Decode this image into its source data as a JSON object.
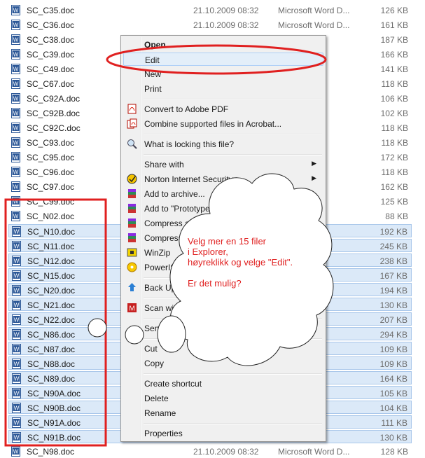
{
  "files": [
    {
      "name": "SC_C35.doc",
      "date": "21.10.2009 08:32",
      "type": "Microsoft Word D...",
      "size": "126 KB",
      "selected": false
    },
    {
      "name": "SC_C36.doc",
      "date": "21.10.2009 08:32",
      "type": "Microsoft Word D...",
      "size": "161 KB",
      "selected": false
    },
    {
      "name": "SC_C38.doc",
      "date": "",
      "type": "",
      "size": "187 KB",
      "selected": false
    },
    {
      "name": "SC_C39.doc",
      "date": "",
      "type": "",
      "size": "166 KB",
      "selected": false
    },
    {
      "name": "SC_C49.doc",
      "date": "",
      "type": "",
      "size": "141 KB",
      "selected": false
    },
    {
      "name": "SC_C67.doc",
      "date": "",
      "type": "",
      "size": "118 KB",
      "selected": false
    },
    {
      "name": "SC_C92A.doc",
      "date": "",
      "type": "",
      "size": "106 KB",
      "selected": false
    },
    {
      "name": "SC_C92B.doc",
      "date": "",
      "type": "",
      "size": "102 KB",
      "selected": false
    },
    {
      "name": "SC_C92C.doc",
      "date": "",
      "type": "",
      "size": "118 KB",
      "selected": false
    },
    {
      "name": "SC_C93.doc",
      "date": "",
      "type": "",
      "size": "118 KB",
      "selected": false
    },
    {
      "name": "SC_C95.doc",
      "date": "",
      "type": "",
      "size": "172 KB",
      "selected": false
    },
    {
      "name": "SC_C96.doc",
      "date": "",
      "type": "",
      "size": "118 KB",
      "selected": false
    },
    {
      "name": "SC_C97.doc",
      "date": "",
      "type": "",
      "size": "162 KB",
      "selected": false
    },
    {
      "name": "SC_C99.doc",
      "date": "",
      "type": "",
      "size": "125 KB",
      "selected": false
    },
    {
      "name": "SC_N02.doc",
      "date": "",
      "type": "",
      "size": "88 KB",
      "selected": false
    },
    {
      "name": "SC_N10.doc",
      "date": "",
      "type": "",
      "size": "192 KB",
      "selected": true
    },
    {
      "name": "SC_N11.doc",
      "date": "",
      "type": "",
      "size": "245 KB",
      "selected": true
    },
    {
      "name": "SC_N12.doc",
      "date": "",
      "type": "",
      "size": "238 KB",
      "selected": true
    },
    {
      "name": "SC_N15.doc",
      "date": "",
      "type": "",
      "size": "167 KB",
      "selected": true
    },
    {
      "name": "SC_N20.doc",
      "date": "",
      "type": "",
      "size": "194 KB",
      "selected": true
    },
    {
      "name": "SC_N21.doc",
      "date": "",
      "type": "",
      "size": "130 KB",
      "selected": true
    },
    {
      "name": "SC_N22.doc",
      "date": "",
      "type": "",
      "size": "207 KB",
      "selected": true
    },
    {
      "name": "SC_N86.doc",
      "date": "",
      "type": "",
      "size": "294 KB",
      "selected": true
    },
    {
      "name": "SC_N87.doc",
      "date": "",
      "type": "",
      "size": "109 KB",
      "selected": true
    },
    {
      "name": "SC_N88.doc",
      "date": "",
      "type": "",
      "size": "109 KB",
      "selected": true
    },
    {
      "name": "SC_N89.doc",
      "date": "",
      "type": "",
      "size": "164 KB",
      "selected": true
    },
    {
      "name": "SC_N90A.doc",
      "date": "",
      "type": "",
      "size": "105 KB",
      "selected": true
    },
    {
      "name": "SC_N90B.doc",
      "date": "",
      "type": "",
      "size": "104 KB",
      "selected": true
    },
    {
      "name": "SC_N91A.doc",
      "date": "",
      "type": "",
      "size": "111 KB",
      "selected": true
    },
    {
      "name": "SC_N91B.doc",
      "date": "",
      "type": "",
      "size": "130 KB",
      "selected": true
    },
    {
      "name": "SC_N98.doc",
      "date": "21.10.2009 08:32",
      "type": "Microsoft Word D...",
      "size": "128 KB",
      "selected": false
    }
  ],
  "menu": {
    "items": [
      {
        "label": "Open",
        "icon": "",
        "bold": true,
        "submenu": false
      },
      {
        "label": "Edit",
        "icon": "",
        "bold": false,
        "submenu": false,
        "highlighted": true
      },
      {
        "label": "New",
        "icon": "",
        "bold": false,
        "submenu": false
      },
      {
        "label": "Print",
        "icon": "",
        "bold": false,
        "submenu": false
      },
      {
        "sep": true
      },
      {
        "label": "Convert to Adobe PDF",
        "icon": "pdf-icon",
        "bold": false,
        "submenu": false
      },
      {
        "label": "Combine supported files in Acrobat...",
        "icon": "acrobat-combine-icon",
        "bold": false,
        "submenu": false
      },
      {
        "sep": true
      },
      {
        "label": "What is locking this file?",
        "icon": "magnifier-lock-icon",
        "bold": false,
        "submenu": false
      },
      {
        "sep": true
      },
      {
        "label": "Share with",
        "icon": "",
        "bold": false,
        "submenu": true
      },
      {
        "label": "Norton Internet Security",
        "icon": "norton-icon",
        "bold": false,
        "submenu": true
      },
      {
        "label": "Add to archive...",
        "icon": "winrar-icon",
        "bold": false,
        "submenu": false
      },
      {
        "label": "Add to \"Prototype.rar\"",
        "icon": "winrar-icon",
        "bold": false,
        "submenu": false
      },
      {
        "label": "Compress and email...",
        "icon": "winrar-icon",
        "bold": false,
        "submenu": false
      },
      {
        "label": "Compress to \"Prototype.rar\" and email",
        "icon": "winrar-icon",
        "bold": false,
        "submenu": false
      },
      {
        "label": "WinZip",
        "icon": "winzip-icon",
        "bold": false,
        "submenu": true
      },
      {
        "label": "PowerISO",
        "icon": "poweriso-icon",
        "bold": false,
        "submenu": true
      },
      {
        "sep": true
      },
      {
        "label": "Back Up",
        "icon": "backup-icon",
        "bold": false,
        "submenu": false
      },
      {
        "sep": true
      },
      {
        "label": "Scan with Malwarebytes",
        "icon": "malwarebytes-icon",
        "bold": false,
        "submenu": false
      },
      {
        "sep": true
      },
      {
        "label": "Send to",
        "icon": "",
        "bold": false,
        "submenu": true
      },
      {
        "sep": true
      },
      {
        "label": "Cut",
        "icon": "",
        "bold": false,
        "submenu": false
      },
      {
        "label": "Copy",
        "icon": "",
        "bold": false,
        "submenu": false
      },
      {
        "sep": true
      },
      {
        "label": "Create shortcut",
        "icon": "",
        "bold": false,
        "submenu": false
      },
      {
        "label": "Delete",
        "icon": "",
        "bold": false,
        "submenu": false
      },
      {
        "label": "Rename",
        "icon": "",
        "bold": false,
        "submenu": false
      },
      {
        "sep": true
      },
      {
        "label": "Properties",
        "icon": "",
        "bold": false,
        "submenu": false
      }
    ]
  },
  "annotation": {
    "cloud_text": "Velg mer en 15 filer\ni Explorer,\nhøyreklikk og velge \"Edit\".\n\nEr det mulig?",
    "color": "#e02020"
  },
  "colors": {
    "selection": "#dbe9f8",
    "selection_border": "#a9c7ea",
    "annotation": "#e02020"
  }
}
